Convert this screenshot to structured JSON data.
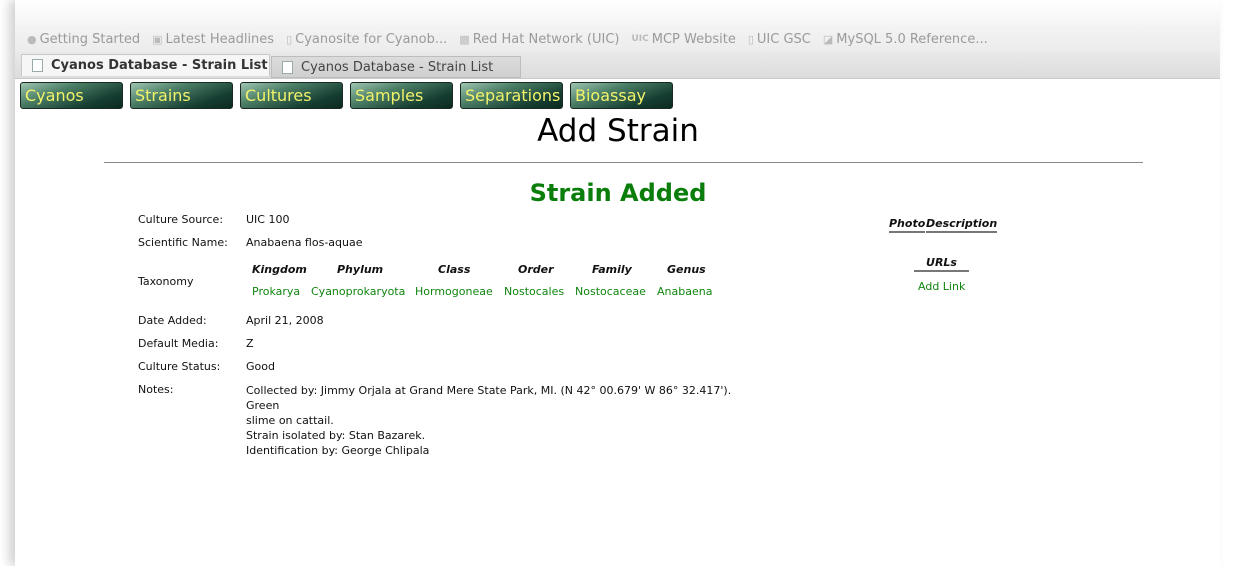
{
  "bookmarks": [
    {
      "label": "Getting Started",
      "icon": "firefox-icon"
    },
    {
      "label": "Latest Headlines",
      "icon": "rss-icon"
    },
    {
      "label": "Cyanosite for Cyanob...",
      "icon": "page-icon"
    },
    {
      "label": "Red Hat Network (UIC)",
      "icon": "redhat-icon"
    },
    {
      "label": "MCP Website",
      "icon": "uic-icon"
    },
    {
      "label": "UIC GSC",
      "icon": "page-icon"
    },
    {
      "label": "MySQL 5.0 Reference...",
      "icon": "mysql-icon"
    }
  ],
  "tabs": [
    {
      "label": "Cyanos Database - Strain List",
      "active": true
    },
    {
      "label": "Cyanos Database - Strain List",
      "active": false
    }
  ],
  "nav": [
    "Cyanos",
    "Strains",
    "Cultures",
    "Samples",
    "Separations",
    "Bioassay"
  ],
  "page_title": "Add Strain",
  "status_message": "Strain Added",
  "fields": {
    "culture_source": {
      "label": "Culture Source:",
      "value": "UIC 100"
    },
    "scientific_name": {
      "label": "Scientific Name:",
      "value": "Anabaena flos-aquae"
    },
    "taxonomy_label": "Taxonomy",
    "date_added": {
      "label": "Date Added:",
      "value": "April 21, 2008"
    },
    "default_media": {
      "label": "Default Media:",
      "value": "Z"
    },
    "culture_status": {
      "label": "Culture Status:",
      "value": "Good"
    },
    "notes_label": "Notes:",
    "notes_lines": [
      "Collected by: Jimmy Orjala at Grand Mere State Park, MI. (N 42° 00.679' W 86° 32.417'). Green",
      "slime on cattail.",
      "Strain isolated by: Stan Bazarek.",
      "Identification by: George Chlipala"
    ]
  },
  "taxonomy": {
    "headers": [
      "Kingdom",
      "Phylum",
      "Class",
      "Order",
      "Family",
      "Genus"
    ],
    "values": [
      "Prokarya",
      "Cyanoprokaryota",
      "Hormogoneae",
      "Nostocales",
      "Nostocaceae",
      "Anabaena"
    ]
  },
  "side": {
    "photo_header": "Photo",
    "description_header": "Description",
    "urls_header": "URLs",
    "add_link": "Add Link"
  },
  "colors": {
    "nav_text": "#f3f36a",
    "status_green": "#0b7d0b",
    "link_green": "#108510"
  }
}
